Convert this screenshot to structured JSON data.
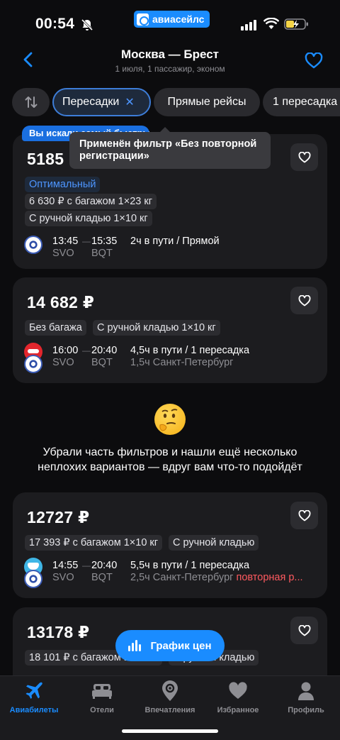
{
  "status_bar": {
    "time": "00:54",
    "brand": "авиасейлс"
  },
  "header": {
    "title": "Москва — Брест",
    "subtitle": "1 июля, 1 пассажир, эконом"
  },
  "filters": {
    "active": "Пересадки",
    "direct": "Прямые рейсы",
    "one_transfer": "1 пересадка"
  },
  "ribbon": "Вы искали самый быстрый",
  "tooltip": "Применён фильтр «Без повторной регистрации»",
  "cards": [
    {
      "price": "5185",
      "tags": [
        "Оптимальный",
        "6 630 ₽ с багажом 1×23 кг",
        "С ручной кладью 1×10 кг"
      ],
      "dep_time": "13:45",
      "arr_time": "15:35",
      "dep_code": "SVO",
      "arr_code": "BQT",
      "duration": "2ч в пути / Прямой"
    },
    {
      "price": "14 682 ₽",
      "tags": [
        "Без багажа",
        "С ручной кладью 1×10 кг"
      ],
      "dep_time": "16:00",
      "arr_time": "20:40",
      "dep_code": "SVO",
      "arr_code": "BQT",
      "duration": "4,5ч в пути / 1 пересадка",
      "transfer": "1,5ч Санкт-Петербург"
    },
    {
      "price": "12727 ₽",
      "tags": [
        "17 393 ₽ с багажом 1×10 кг",
        "С ручной кладью"
      ],
      "dep_time": "14:55",
      "arr_time": "20:40",
      "dep_code": "SVO",
      "arr_code": "BQT",
      "duration": "5,5ч в пути / 1 пересадка",
      "transfer": "2,5ч Санкт-Петербург",
      "warning": "повторная р..."
    },
    {
      "price": "13178 ₽",
      "tags": [
        "18 101 ₽ с багажом 1×10 кг",
        "С ручной кладью"
      ]
    }
  ],
  "notice": {
    "line1": "Убрали часть фильтров и нашли ещё несколько",
    "line2": "неплохих вариантов — вдруг вам что-то подойдёт"
  },
  "price_chart_button": "График цен",
  "tabs": [
    {
      "label": "Авиабилеты",
      "icon": "plane-icon"
    },
    {
      "label": "Отели",
      "icon": "bed-icon"
    },
    {
      "label": "Впечатления",
      "icon": "map-pin-icon"
    },
    {
      "label": "Избранное",
      "icon": "heart-icon"
    },
    {
      "label": "Профиль",
      "icon": "person-icon"
    }
  ],
  "colors": {
    "accent": "#1a8cff",
    "warning": "#ff5a5f",
    "card": "#1c1c1f"
  }
}
